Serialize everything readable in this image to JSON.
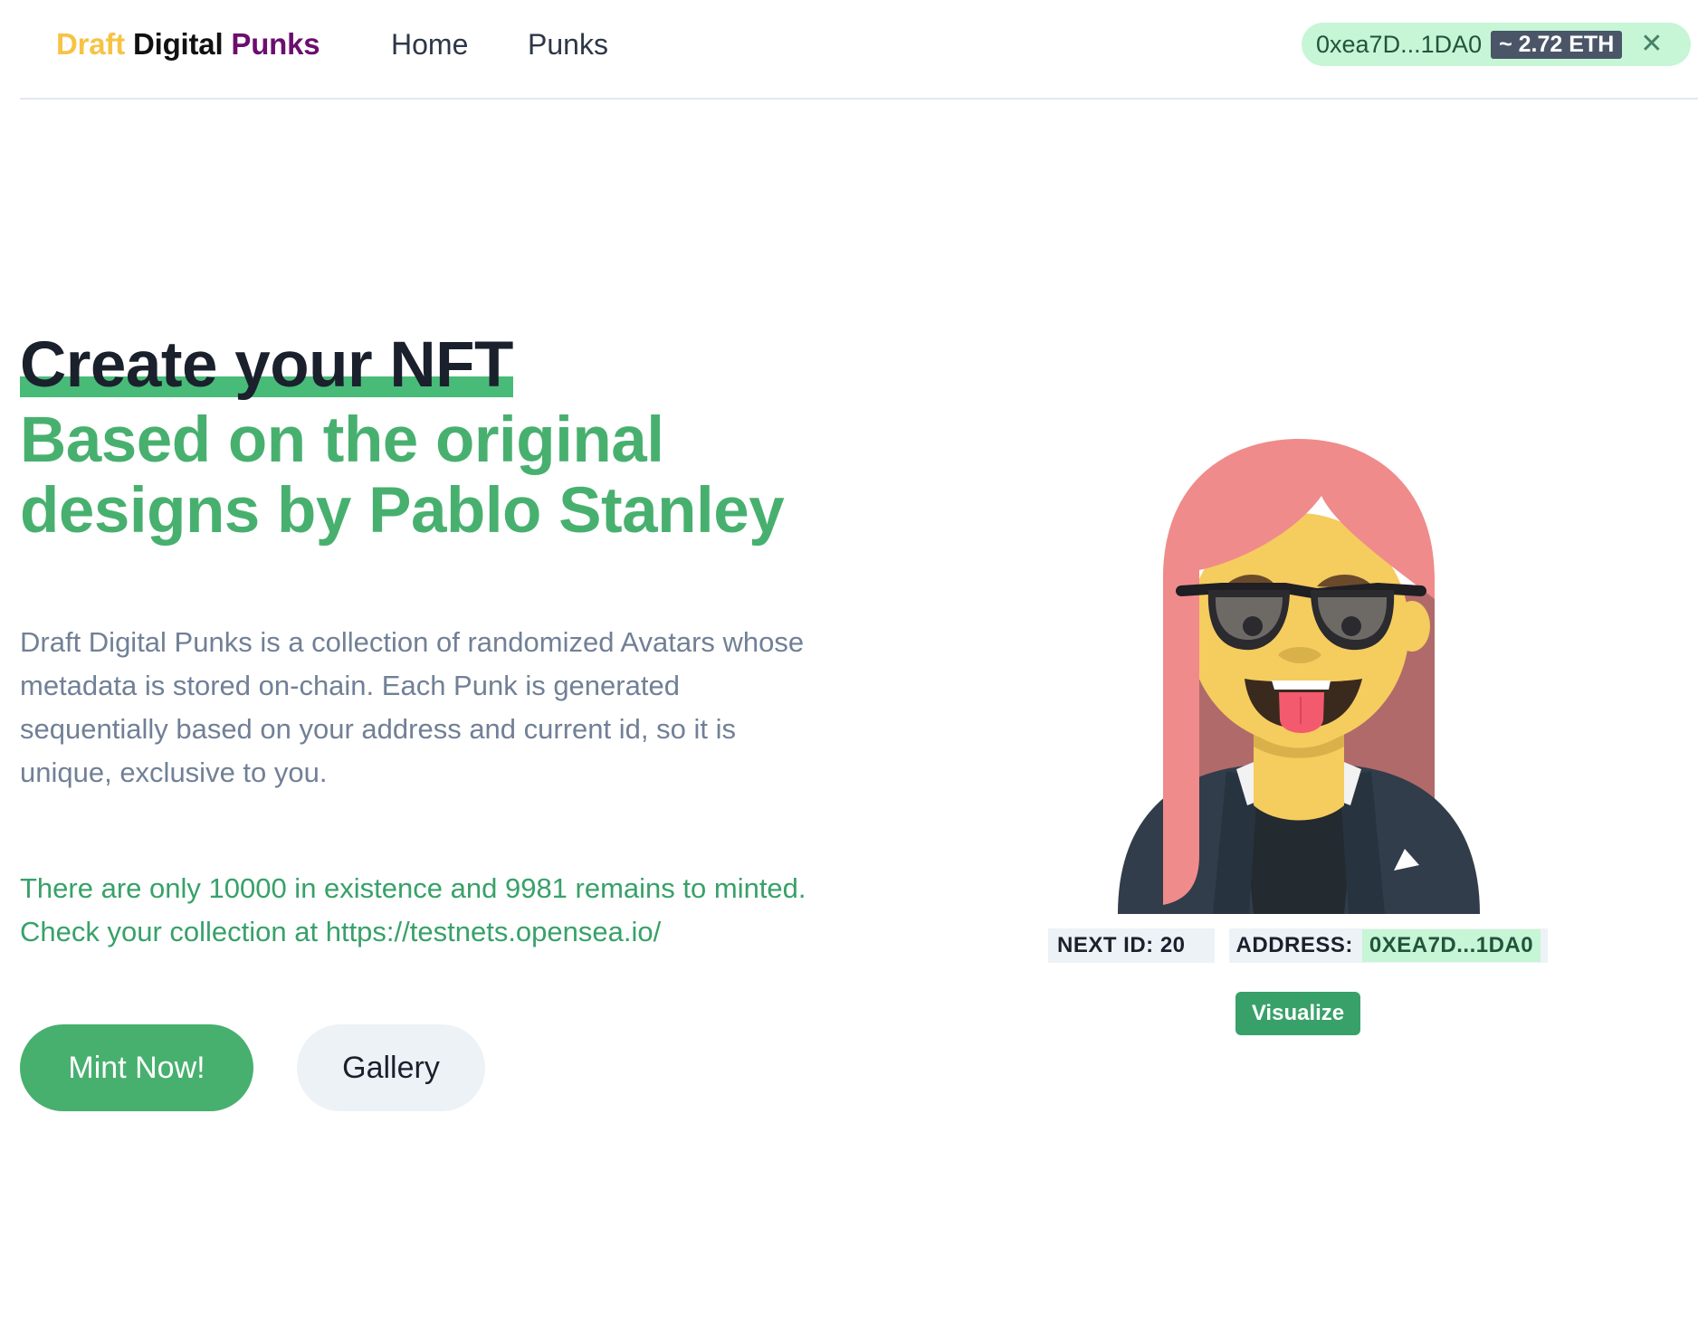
{
  "navbar": {
    "brand": {
      "part1": "Draft",
      "part2": "Digital",
      "part3": "Punks"
    },
    "links": [
      {
        "label": "Home"
      },
      {
        "label": "Punks"
      }
    ],
    "wallet": {
      "address": "0xea7D...1DA0",
      "balance": "~ 2.72 ETH",
      "close_icon": "close-icon"
    }
  },
  "hero": {
    "title": "Create your NFT",
    "subtitle": "Based on the original designs by Pablo Stanley",
    "description": "Draft Digital Punks is a collection of randomized Avatars whose metadata is stored on-chain. Each Punk is generated sequentially based on your address and current id, so it is unique, exclusive to you.",
    "supply_text": "There are only 10000 in existence and 9981 remains to minted. Check your collection at https://testnets.opensea.io/",
    "mint_label": "Mint Now!",
    "gallery_label": "Gallery"
  },
  "preview": {
    "next_id_label": "NEXT ID: 20",
    "address_label": "ADDRESS:",
    "address_value": "0XEA7D...1DA0",
    "visualize_label": "Visualize"
  },
  "colors": {
    "accent_green": "#48b06f",
    "brand_yellow": "#f6c344",
    "brand_purple": "#6b0e6e",
    "wallet_bg": "#c6f6d5",
    "hair": "#f08b8b",
    "skin": "#f5cc5e",
    "jacket": "#313d4a"
  }
}
